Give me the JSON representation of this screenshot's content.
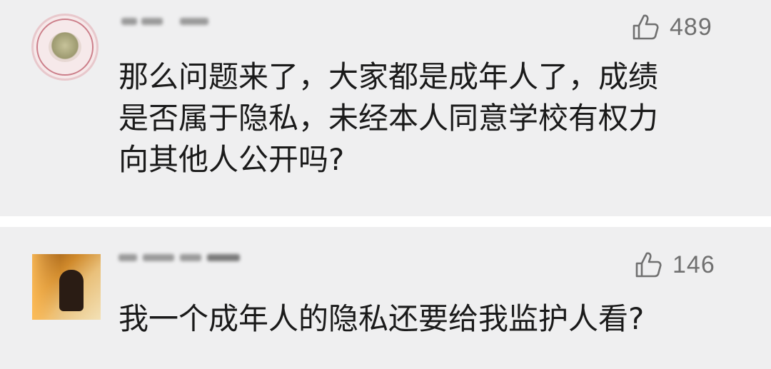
{
  "comments": [
    {
      "likes": "489",
      "text": "那么问题来了，大家都是成年人了，成绩\n是否属于隐私，未经本人同意学校有权力\n向其他人公开吗?"
    },
    {
      "likes": "146",
      "text": "我一个成年人的隐私还要给我监护人看?"
    }
  ],
  "icons": {
    "like": "thumbs-up-icon"
  },
  "colors": {
    "card_background": "#efeff0",
    "separator": "#ffffff",
    "text": "#1a1a1a",
    "like_count": "#707070"
  }
}
